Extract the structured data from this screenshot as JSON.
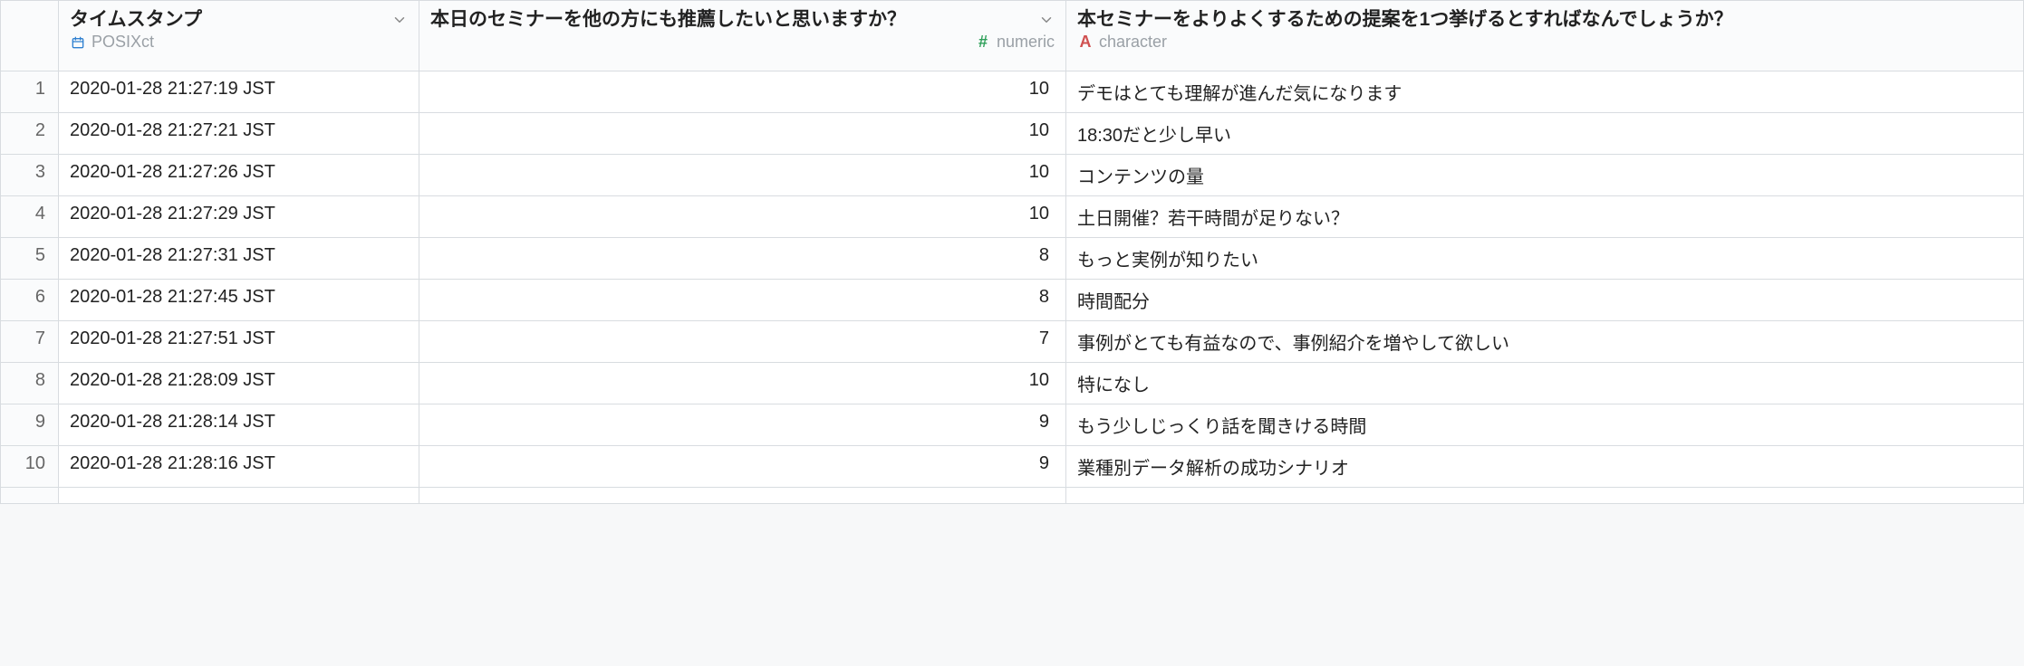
{
  "columns": {
    "timestamp": {
      "title": "タイムスタンプ",
      "type_label": "POSIXct"
    },
    "recommend": {
      "title": "本日のセミナーを他の方にも推薦したいと思いますか？",
      "type_label": "numeric"
    },
    "suggestion": {
      "title": "本セミナーをよりよくするための提案を1つ挙げるとすればなんでしょうか？",
      "type_label": "character"
    }
  },
  "rows": [
    {
      "idx": "1",
      "timestamp": "2020-01-28 21:27:19 JST",
      "recommend": "10",
      "suggestion": "デモはとても理解が進んだ気になります"
    },
    {
      "idx": "2",
      "timestamp": "2020-01-28 21:27:21 JST",
      "recommend": "10",
      "suggestion": "18:30だと少し早い"
    },
    {
      "idx": "3",
      "timestamp": "2020-01-28 21:27:26 JST",
      "recommend": "10",
      "suggestion": "コンテンツの量"
    },
    {
      "idx": "4",
      "timestamp": "2020-01-28 21:27:29 JST",
      "recommend": "10",
      "suggestion": "土日開催？若干時間が足りない？"
    },
    {
      "idx": "5",
      "timestamp": "2020-01-28 21:27:31 JST",
      "recommend": "8",
      "suggestion": "もっと実例が知りたい"
    },
    {
      "idx": "6",
      "timestamp": "2020-01-28 21:27:45 JST",
      "recommend": "8",
      "suggestion": "時間配分"
    },
    {
      "idx": "7",
      "timestamp": "2020-01-28 21:27:51 JST",
      "recommend": "7",
      "suggestion": "事例がとても有益なので、事例紹介を増やして欲しい"
    },
    {
      "idx": "8",
      "timestamp": "2020-01-28 21:28:09 JST",
      "recommend": "10",
      "suggestion": "特になし"
    },
    {
      "idx": "9",
      "timestamp": "2020-01-28 21:28:14 JST",
      "recommend": "9",
      "suggestion": "もう少しじっくり話を聞きける時間"
    },
    {
      "idx": "10",
      "timestamp": "2020-01-28 21:28:16 JST",
      "recommend": "9",
      "suggestion": "業種別データ解析の成功シナリオ"
    }
  ]
}
